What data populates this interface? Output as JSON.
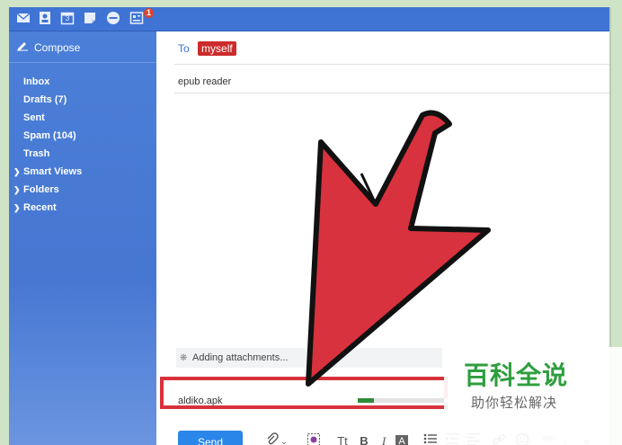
{
  "topbar": {
    "icons": [
      "mail-icon",
      "contacts-icon",
      "calendar-icon",
      "notepad-icon",
      "messenger-icon",
      "newsfeed-icon"
    ],
    "calendar_day": "3",
    "badge_count": "1",
    "accent_color": "#3f74d4"
  },
  "sidebar": {
    "compose_label": "Compose",
    "items": [
      {
        "label": "Inbox"
      },
      {
        "label": "Drafts (7)"
      },
      {
        "label": "Sent"
      },
      {
        "label": "Spam (104)"
      },
      {
        "label": "Trash"
      },
      {
        "label": "Smart Views"
      },
      {
        "label": "Folders"
      },
      {
        "label": "Recent"
      }
    ]
  },
  "compose": {
    "to_label": "To",
    "recipient": "myself",
    "subject": "epub reader",
    "status": "Adding attachments...",
    "attachment": {
      "name": "aldiko.apk",
      "progress": 0.18
    },
    "send_label": "Send",
    "format_labels": {
      "text_style": "Tt",
      "bold": "B",
      "italic": "I",
      "text_color": "A",
      "spellcheck": "abc"
    }
  },
  "annotation": {
    "arrow_color": "#d8323e"
  },
  "watermark": {
    "title": "百科全说",
    "subtitle": "助你轻松解决"
  }
}
